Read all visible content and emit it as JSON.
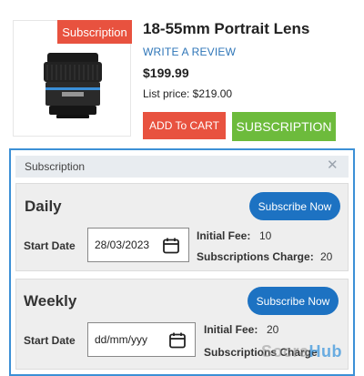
{
  "product": {
    "badge": "Subscription",
    "title": "18-55mm Portrait Lens",
    "review_link": "WRITE A REVIEW",
    "price": "$199.99",
    "list_price": "List price: $219.00",
    "add_to_cart": "ADD To CART",
    "subscription_button": "SUBSCRIPTION"
  },
  "panel": {
    "title": "Subscription",
    "close": "✕",
    "plans": [
      {
        "name": "Daily",
        "subscribe_label": "Subscribe Now",
        "start_date_label": "Start Date",
        "start_date_value": "28/03/2023",
        "initial_fee_label": "Initial Fee:",
        "initial_fee_value": "10",
        "charge_label": "Subscriptions Charge:",
        "charge_value": "20"
      },
      {
        "name": "Weekly",
        "subscribe_label": "Subscribe Now",
        "start_date_label": "Start Date",
        "start_date_value": "dd/mm/yyy",
        "initial_fee_label": "Initial Fee:",
        "initial_fee_value": "20",
        "charge_label": "Subscriptions Charge"
      }
    ]
  },
  "watermark": {
    "part1": "Socra",
    "part2": "Hub"
  },
  "colors": {
    "badge_red": "#e8523f",
    "subscription_green": "#6dbb3c",
    "subscribe_now_blue": "#1d72c2",
    "panel_border": "#3c90d6",
    "link_blue": "#2f76b8"
  }
}
